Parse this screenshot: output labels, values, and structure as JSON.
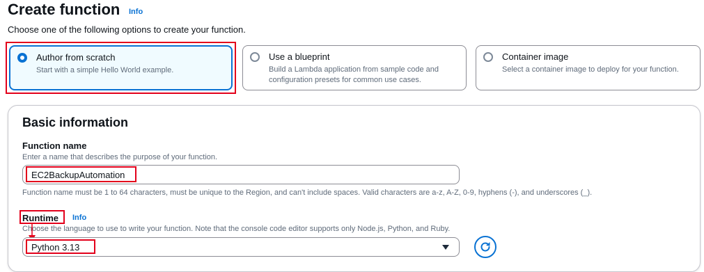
{
  "header": {
    "title": "Create function",
    "info_link": "Info",
    "subtitle": "Choose one of the following options to create your function."
  },
  "options": [
    {
      "title": "Author from scratch",
      "description": "Start with a simple Hello World example.",
      "selected": true
    },
    {
      "title": "Use a blueprint",
      "description": "Build a Lambda application from sample code and configuration presets for common use cases.",
      "selected": false
    },
    {
      "title": "Container image",
      "description": "Select a container image to deploy for your function.",
      "selected": false
    }
  ],
  "basic_info": {
    "title": "Basic information",
    "function_name": {
      "label": "Function name",
      "description": "Enter a name that describes the purpose of your function.",
      "value": "EC2BackupAutomation",
      "constraint": "Function name must be 1 to 64 characters, must be unique to the Region, and can't include spaces. Valid characters are a-z, A-Z, 0-9, hyphens (-), and underscores (_)."
    },
    "runtime": {
      "label": "Runtime",
      "info_link": "Info",
      "description": "Choose the language to use to write your function. Note that the console code editor supports only Node.js, Python, and Ruby.",
      "value": "Python 3.13"
    }
  },
  "colors": {
    "accent": "#0972d3",
    "annotation_red": "#e3001b"
  },
  "icons": {
    "dropdown": "caret-down-icon",
    "refresh": "refresh-icon"
  }
}
